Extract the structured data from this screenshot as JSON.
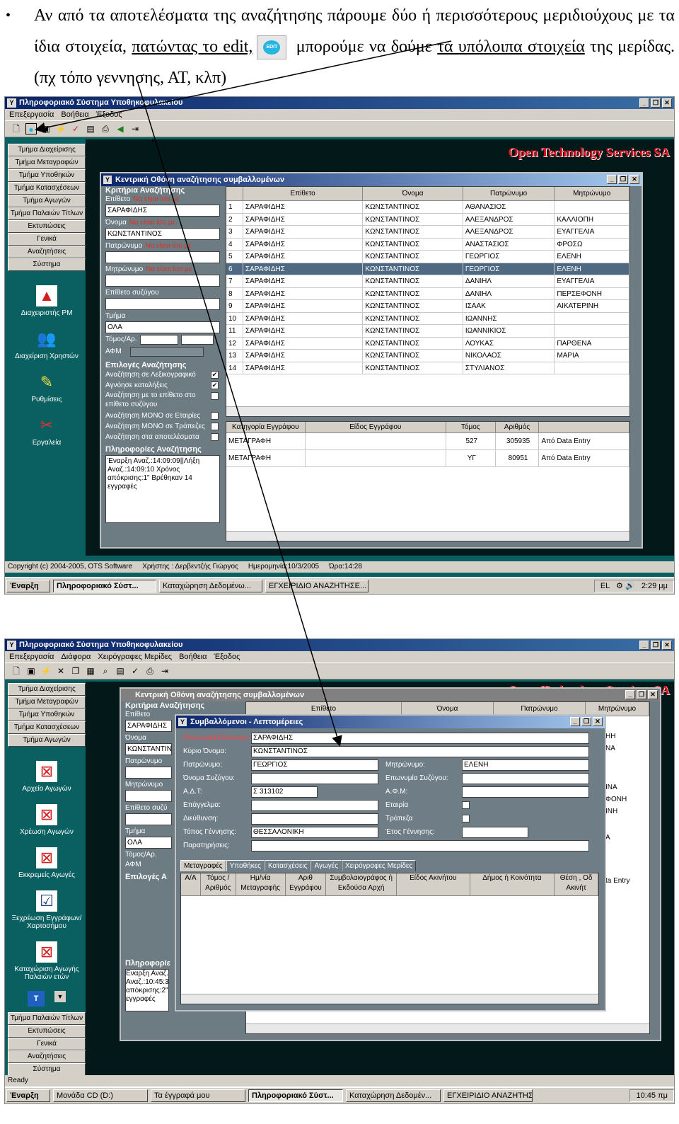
{
  "doc": {
    "bullet": "•",
    "text_part1": "Αν από τα αποτελέσματα της αναζήτησης πάρουμε δύο ή περισσότερους μεριδιούχους με τα ίδια στοιχεία, ",
    "link1": "πατώντας το edit,",
    "edit_icon_label": "EDIT",
    "text_part2": " μπορούμε να δούμε ",
    "link2": "τα υπόλοιπα στοιχεία",
    "text_part3": " της μερίδας.(πχ τόπο γεννησης, ΑΤ, κλπ)"
  },
  "shot1": {
    "app_title": "Πληροφοριακό Σύστημα Υποθηκοφυλακείου",
    "window_buttons": [
      "_",
      "❐",
      "✕"
    ],
    "menu": [
      "Επεξεργασία",
      "Βοήθεια",
      "Έξοδος"
    ],
    "toolbar_icons": [
      "new-icon",
      "edit-icon",
      "save-icon",
      "run-icon",
      "check-icon",
      "report-icon",
      "print-icon",
      "back-icon",
      "exit-icon"
    ],
    "sidebar": [
      "Τμήμα Διαχείρισης",
      "Τμήμα Μεταγραφών",
      "Τμήμα Υποθηκών",
      "Τμήμα Κατασχέσεων",
      "Τμήμα Αγωγών",
      "Τμήμα Παλαιών Τίτλων",
      "Εκτυπώσεις",
      "Γενικά",
      "Αναζητήσεις",
      "Σύστημα"
    ],
    "sidetools": [
      {
        "label": "Διαχειριστής ΡΜ",
        "icon": "ots-logo-icon"
      },
      {
        "label": "Διαχείριση Χρηστών",
        "icon": "users-icon"
      },
      {
        "label": "Ρυθμίσεις",
        "icon": "settings-icon"
      },
      {
        "label": "Εργαλεία",
        "icon": "tools-icon"
      }
    ],
    "brand": "Open Technology Services SA",
    "search_window": {
      "title": "Κεντρική Οθόνη αναζήτησης συμβαλλομένων",
      "criteria_head": "Κριτήρια Αναζήτησης",
      "surname_label": "Επίθετο",
      "name_label": "Όνομα",
      "father_label": "Πατρώνυμο",
      "mother_label": "Μητρώνυμο",
      "equals": "Να είναι ίσο με",
      "surname_value": "ΣΑΡΑΦΙΔΗΣ",
      "name_value": "ΚΩΝΣΤΑΝΤΙΝΟΣ",
      "spouse_label": "Επίθετο συζύγου",
      "dept_label": "Τμήμα",
      "dept_value": "ΟΛΑ",
      "volume_label": "Τόμος/Αρ.",
      "afm_label": "ΑΦΜ",
      "options_head": "Επιλογές Αναζήτησης",
      "options": [
        {
          "label": "Αναζήτηση σε Λεξικογραφικό",
          "checked": "✔"
        },
        {
          "label": "Αγνόησε καταλήξεις",
          "checked": "✔"
        },
        {
          "label": "Αναζήτηση με το επίθετο στο επίθετο συζύγου",
          "checked": ""
        },
        {
          "label": "Αναζήτηση ΜΟΝΟ σε Εταιρίες",
          "checked": ""
        },
        {
          "label": "Αναζήτηση ΜΟΝΟ σε Τράπεζες",
          "checked": ""
        },
        {
          "label": "Αναζήτηση στα αποτελέσματα",
          "checked": ""
        }
      ],
      "info_head": "Πληροφορίες Αναζήτησης",
      "info_text": "Έναρξη Αναζ.:14:09:09||Λήξη Αναζ.:14:09:10 Χρόνος απόκρισης:1\" Βρέθηκαν 14 εγγραφές",
      "columns": [
        "",
        "Επίθετο",
        "Όνομα",
        "Πατρώνυμο",
        "Μητρώνυμο"
      ],
      "rows": [
        [
          "1",
          "ΣΑΡΑΦΙΔΗΣ",
          "ΚΩΝΣΤΑΝΤΙΝΟΣ",
          "ΑΘΑΝΑΣΙΟΣ",
          ""
        ],
        [
          "2",
          "ΣΑΡΑΦΙΔΗΣ",
          "ΚΩΝΣΤΑΝΤΙΝΟΣ",
          "ΑΛΕΞΑΝΔΡΟΣ",
          "ΚΑΛΛΙΟΠΗ"
        ],
        [
          "3",
          "ΣΑΡΑΦΙΔΗΣ",
          "ΚΩΝΣΤΑΝΤΙΝΟΣ",
          "ΑΛΕΞΑΝΔΡΟΣ",
          "ΕΥΑΓΓΕΛΙΑ"
        ],
        [
          "4",
          "ΣΑΡΑΦΙΔΗΣ",
          "ΚΩΝΣΤΑΝΤΙΝΟΣ",
          "ΑΝΑΣΤΑΣΙΟΣ",
          "ΦΡΟΣΩ"
        ],
        [
          "5",
          "ΣΑΡΑΦΙΔΗΣ",
          "ΚΩΝΣΤΑΝΤΙΝΟΣ",
          "ΓΕΩΡΓΙΟΣ",
          "ΕΛΕΝΗ"
        ],
        [
          "6",
          "ΣΑΡΑΦΙΔΗΣ",
          "ΚΩΝΣΤΑΝΤΙΝΟΣ",
          "ΓΕΩΡΓΙΟΣ",
          "ΕΛΕΝΗ"
        ],
        [
          "7",
          "ΣΑΡΑΦΙΔΗΣ",
          "ΚΩΝΣΤΑΝΤΙΝΟΣ",
          "ΔΑΝΙΗΛ",
          "ΕΥΑΓΓΕΛΙΑ"
        ],
        [
          "8",
          "ΣΑΡΑΦΙΔΗΣ",
          "ΚΩΝΣΤΑΝΤΙΝΟΣ",
          "ΔΑΝΙΗΛ",
          "ΠΕΡΣΕΦΟΝΗ"
        ],
        [
          "9",
          "ΣΑΡΑΦΙΔΗΣ",
          "ΚΩΝΣΤΑΝΤΙΝΟΣ",
          "ΙΣΑΑΚ",
          "ΑΙΚΑΤΕΡΙΝΗ"
        ],
        [
          "10",
          "ΣΑΡΑΦΙΔΗΣ",
          "ΚΩΝΣΤΑΝΤΙΝΟΣ",
          "ΙΩΑΝΝΗΣ",
          ""
        ],
        [
          "11",
          "ΣΑΡΑΦΙΔΗΣ",
          "ΚΩΝΣΤΑΝΤΙΝΟΣ",
          "ΙΩΑΝΝΙΚΙΟΣ",
          ""
        ],
        [
          "12",
          "ΣΑΡΑΦΙΔΗΣ",
          "ΚΩΝΣΤΑΝΤΙΝΟΣ",
          "ΛΟΥΚΑΣ",
          "ΠΑΡΘΕΝΑ"
        ],
        [
          "13",
          "ΣΑΡΑΦΙΔΗΣ",
          "ΚΩΝΣΤΑΝΤΙΝΟΣ",
          "ΝΙΚΟΛΑΟΣ",
          "ΜΑΡΙΑ"
        ],
        [
          "14",
          "ΣΑΡΑΦΙΔΗΣ",
          "ΚΩΝΣΤΑΝΤΙΝΟΣ",
          "ΣΤΥΛΙΑΝΟΣ",
          ""
        ]
      ],
      "selected_row": 5,
      "doc_columns": [
        "Κατηγορία Εγγράφου",
        "Είδος Εγγράφου",
        "Τόμος",
        "Αριθμός",
        ""
      ],
      "doc_rows": [
        [
          "ΜΕΤΑΓΡΑΦΗ",
          "",
          "527",
          "305935",
          "Από Data Entry"
        ],
        [
          "ΜΕΤΑΓΡΑΦΗ",
          "",
          "ΥΓ",
          "80951",
          "Από Data Entry"
        ]
      ]
    },
    "status": [
      "Copyright (c) 2004-2005, OTS Software",
      "Χρήστης : Δερβεντζής Γιώργος",
      "Ημερομηνία:10/3/2005",
      "Ώρα:14:28"
    ],
    "taskbar": {
      "start": "Έναρξη",
      "tasks": [
        "Πληροφοριακό Σύστ...",
        "Καταχώρηση Δεδομένω...",
        "ΕΓΧΕΙΡΙΔΙΟ ΑΝΑΖΗΤΗΣΕ..."
      ],
      "lang": "EL",
      "clock": "2:29 μμ"
    }
  },
  "shot2": {
    "app_title": "Πληροφοριακό Σύστημα Υποθηκοφυλακείου",
    "menu": [
      "Επεξεργασία",
      "Διάφορα",
      "Χειρόγραφες Μερίδες",
      "Βοήθεια",
      "Έξοδος"
    ],
    "sidebar_top": [
      "Τμήμα Διαχείρισης",
      "Τμήμα Μεταγραφών",
      "Τμήμα Υποθηκών",
      "Τμήμα Κατασχέσεων",
      "Τμήμα Αγωγών"
    ],
    "sidetools": [
      {
        "label": "Αρχείο Αγωγών",
        "icon": "archive-icon"
      },
      {
        "label": "Χρέωση Αγωγών",
        "icon": "charge-icon"
      },
      {
        "label": "Εκκρεμείς Αγωγές",
        "icon": "pending-icon"
      },
      {
        "label": "Ξεχρέωση Εγγράφων/Χαρτοσήμου",
        "icon": "release-icon"
      },
      {
        "label": "Καταχώριση Αγωγής Παλαιών ετών",
        "icon": "old-entry-icon"
      }
    ],
    "sidebar_bottom": [
      "Τμήμα Παλαιών Τίτλων",
      "Εκτυπώσεις",
      "Γενικά",
      "Αναζητήσεις",
      "Σύστημα"
    ],
    "brand": "Open Technology Services SA",
    "bg_window": {
      "title": "Κεντρική Οθόνη αναζήτησης συμβαλλομένων",
      "criteria_head": "Κριτήρια Αναζήτησης",
      "surname_label": "Επίθετο",
      "surname_value": "ΣΑΡΑΦΙΔΗΣ",
      "name_label": "Όνομα",
      "name_value": "ΚΩΝΣΤΑΝΤΙΝ",
      "father_label": "Πατρώνυμο",
      "mother_label": "Μητρώνυμο",
      "spouse_label": "Επίθετο συζύ",
      "dept_label": "Τμήμα",
      "dept_value": "ΟΛΑ",
      "volume_label": "Τόμος/Αρ.",
      "afm_label": "ΑΦΜ",
      "options_head": "Επιλογές Α",
      "info_head": "Πληροφορίε",
      "info_text": "Εναρξη Αναζ. Αναζ.:10:45:3 απόκρισης:2\" εγγραφές",
      "columns": [
        "Επίθετο",
        "Όνομα",
        "Πατρώνυμο",
        "Μητρώνυμο"
      ],
      "right_cells": [
        "ΗΗ",
        "ΝΑ",
        "ΙΝΑ",
        "ΦΟΝΗ",
        "ΙΝΗ",
        "Α",
        "ta Entry"
      ]
    },
    "detail": {
      "title": "Συμβαλλόμενοι - Λεπτομέρειες",
      "surname_label": "Επωνυμία/Επώνυμο:",
      "surname": "ΣΑΡΑΦΙΔΗΣ",
      "name_label": "Κύριο Όνομα:",
      "name": "ΚΩΝΣΤΑΝΤΙΝΟΣ",
      "father_label": "Πατρώνυμο:",
      "father": "ΓΕΩΡΓΙΟΣ",
      "mother_label": "Μητρώνυμο:",
      "mother": "ΕΛΕΝΗ",
      "spouse_name_label": "Όνομα Συζύγου:",
      "spouse_surname_label": "Επωνυμία Συζύγου:",
      "id_label": "Α.Δ.Τ:",
      "id": "Σ 313102",
      "afm_label": "Α.Φ.Μ:",
      "job_label": "Επάγγελμα:",
      "company_label": "Εταιρία",
      "address_label": "Διεύθυνση:",
      "bank_label": "Τράπεζα",
      "birthplace_label": "Τόπος Γέννησης:",
      "birthplace": "ΘΕΣΣΑΛΟΝΙΚΗ",
      "birthyear_label": "Έτος Γέννησης:",
      "notes_label": "Παρατηρήσεις:",
      "tabs": [
        "Μεταγραφές",
        "Υποθήκες",
        "Κατασχέσεις",
        "Αγωγές",
        "Χειρόγραφες Μερίδες"
      ],
      "columns": [
        "Α/Α",
        "Τόμος / Αριθμός",
        "Ημ/νία Μεταγραφής",
        "Αριθ Εγγράφου",
        "Συμβολαιογράφος ή Εκδούσα Αρχή",
        "Είδος Ακινήτου",
        "Δήμος ή Κοινότητα",
        "Θέση , Οδ Ακινήτ"
      ]
    },
    "status": "Ready",
    "taskbar": {
      "start": "Έναρξη",
      "tasks": [
        "Μονάδα CD (D:)",
        "Τα έγγραφά μου",
        "Πληροφοριακό Σύστ...",
        "Καταχώρηση Δεδομέν...",
        "ΕΓΧΕΙΡΙΔΙΟ ΑΝΑΖΗΤΗΣΗ..."
      ],
      "clock": "10:45 πμ"
    }
  }
}
